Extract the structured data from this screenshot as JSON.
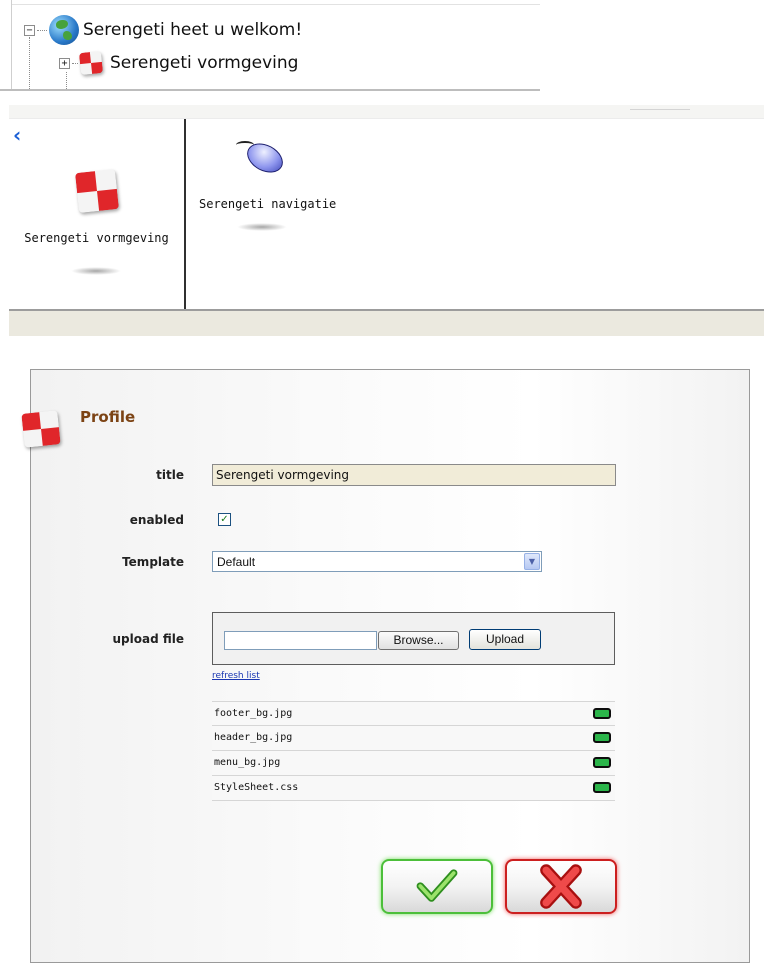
{
  "tree": {
    "root": {
      "label": "Serengeti heet u welkom!",
      "expander": "−"
    },
    "child": {
      "label": "Serengeti vormgeving",
      "expander": "+"
    }
  },
  "icon_panel": {
    "items": [
      {
        "label": "Serengeti vormgeving",
        "icon": "checker-icon"
      },
      {
        "label": "Serengeti navigatie",
        "icon": "mouse-icon"
      }
    ]
  },
  "profile": {
    "heading": "Profile",
    "labels": {
      "title": "title",
      "enabled": "enabled",
      "template": "Template",
      "upload": "upload file"
    },
    "title_value": "Serengeti vormgeving",
    "enabled_checked": true,
    "enabled_mark": "✓",
    "template_value": "Default",
    "browse_label": "Browse...",
    "upload_label": "Upload",
    "refresh_label": "refresh list",
    "files": [
      {
        "name": "footer_bg.jpg"
      },
      {
        "name": "header_bg.jpg"
      },
      {
        "name": "menu_bg.jpg"
      },
      {
        "name": "StyleSheet.css"
      }
    ]
  },
  "colors": {
    "accent_ok": "#4cbf3a",
    "accent_cancel": "#cc1f1f",
    "profile_heading": "#7c4314",
    "link": "#1a37b3"
  }
}
